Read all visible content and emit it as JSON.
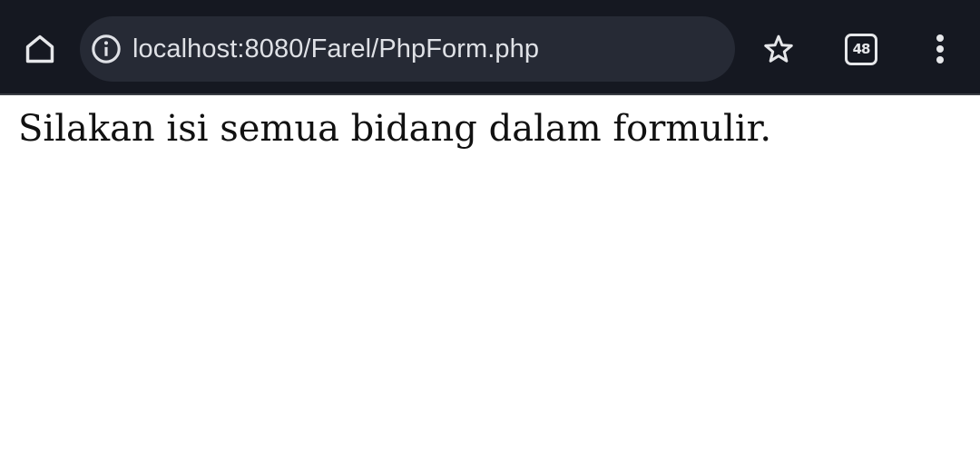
{
  "browser": {
    "url": "localhost:8080/Farel/PhpForm.php",
    "tab_count": "48",
    "icons": {
      "home": "home-icon",
      "site_info": "info-icon",
      "bookmark": "star-icon",
      "tabs": "tab-switcher-icon",
      "menu": "more-vert-icon"
    },
    "colors": {
      "toolbar_bg": "#151821",
      "url_bar_bg": "#262a35",
      "icon": "#e6e7ea"
    }
  },
  "page": {
    "message": "Silakan isi semua bidang dalam formulir."
  }
}
